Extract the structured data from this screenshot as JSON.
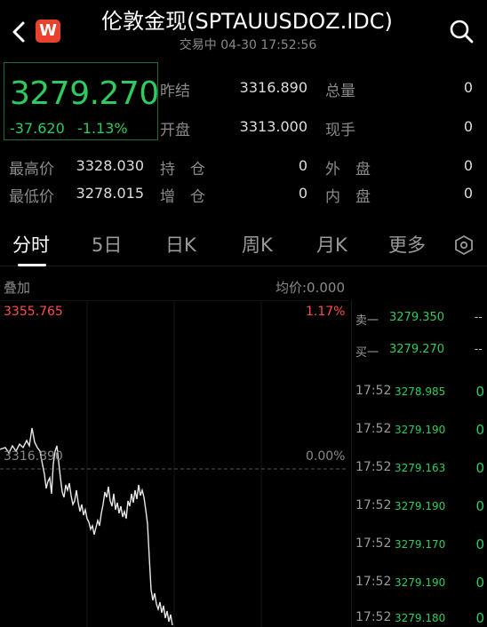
{
  "header": {
    "logo_letter": "W",
    "title": "伦敦金现(SPTAUUSDOZ.IDC)",
    "subtitle": "交易中 04-30 17:52:56"
  },
  "quote": {
    "price": "3279.270",
    "change": "-37.620",
    "change_pct": "-1.13%",
    "prev_close_label": "昨结",
    "prev_close": "3316.890",
    "total_vol_label": "总量",
    "total_vol": "0",
    "open_label": "开盘",
    "open": "3313.000",
    "cur_vol_label": "现手",
    "cur_vol": "0",
    "high_label": "最高价",
    "high": "3328.030",
    "hold_label": "持　仓",
    "hold": "0",
    "outer_label": "外　盘",
    "outer": "0",
    "low_label": "最低价",
    "low": "3278.015",
    "add_label": "增　仓",
    "add": "0",
    "inner_label": "内　盘",
    "inner": "0"
  },
  "tabs": [
    "分时",
    "5日",
    "日K",
    "周K",
    "月K",
    "更多"
  ],
  "chart": {
    "overlay_label": "叠加",
    "avg_label": "均价:0.000",
    "top_price": "3355.765",
    "top_pct": "1.17%",
    "mid_price": "3316.890",
    "mid_pct": "0.00%"
  },
  "book": [
    {
      "label": "卖一",
      "price": "3279.350",
      "vol": "--"
    },
    {
      "label": "买一",
      "price": "3279.270",
      "vol": "--"
    }
  ],
  "trades": [
    {
      "time": "17:52",
      "price": "3278.985",
      "vol": "0"
    },
    {
      "time": "17:52",
      "price": "3279.190",
      "vol": "0"
    },
    {
      "time": "17:52",
      "price": "3279.163",
      "vol": "0"
    },
    {
      "time": "17:52",
      "price": "3279.190",
      "vol": "0"
    },
    {
      "time": "17:52",
      "price": "3279.170",
      "vol": "0"
    },
    {
      "time": "17:52",
      "price": "3279.190",
      "vol": "0"
    },
    {
      "time": "17:52",
      "price": "3279.180",
      "vol": "0"
    }
  ],
  "colors": {
    "up": "#ff4d4d",
    "down": "#2ecc5f",
    "accent_logo": "#e8412c"
  },
  "icons": {
    "back": "chevron-left-icon",
    "search": "search-icon",
    "settings": "hexagon-settings-icon"
  }
}
